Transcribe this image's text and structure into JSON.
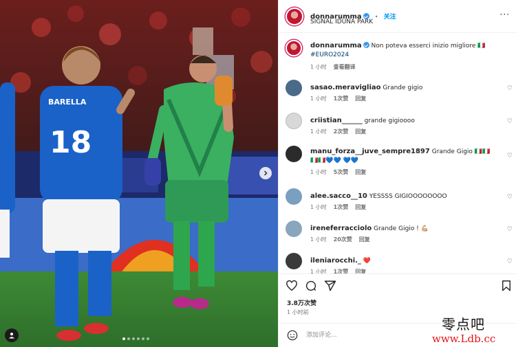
{
  "post": {
    "username": "donnarumma",
    "location": "SIGNAL IDUNA PARK",
    "follow_label": "关注",
    "more_label": "···",
    "caption_text": "Non poteva esserci inizio migliore 🇮🇹",
    "caption_hashtag": "#EURO2024",
    "caption_time": "1 小时",
    "caption_translate": "查看翻译",
    "likes": "3.8万次赞",
    "time_ago": "1 小时前",
    "add_comment_placeholder": "添加评论..."
  },
  "photo": {
    "player_number": "18",
    "player_name": "BARELLA",
    "slide_count": 6,
    "active_slide": 0
  },
  "comments": [
    {
      "username": "sasao.meravigliao",
      "text": "Grande gigio",
      "time": "1 小时",
      "likes": "1次赞",
      "reply": "回复",
      "avatar_color": "#4a6a8a"
    },
    {
      "username": "criistian______",
      "text": "grande gigioooo",
      "time": "1 小时",
      "likes": "2次赞",
      "reply": "回复",
      "avatar_color": "#d8d8d8"
    },
    {
      "username": "manu_forza__juve_sempre1897",
      "text": "Grande Gigio 🇮🇹🇮🇹🇮🇹🇮🇹💙💙 💙💙",
      "time": "1 小时",
      "likes": "5次赞",
      "reply": "回复",
      "avatar_color": "#2b2b2b"
    },
    {
      "username": "alee.sacco__10",
      "text": "YESSSS GIGIOOOOOOOO",
      "time": "1 小时",
      "likes": "1次赞",
      "reply": "回复",
      "avatar_color": "#7aa0c0"
    },
    {
      "username": "ireneferracciolo",
      "text": "Grande Gigio ! 💪🏼",
      "time": "1 小时",
      "likes": "20次赞",
      "reply": "回复",
      "avatar_color": "#8aa6bd"
    },
    {
      "username": "ileniarocchi._",
      "text": "❤️",
      "time": "1 小时",
      "likes": "1次赞",
      "reply": "回复",
      "avatar_color": "#3a3a3a"
    }
  ],
  "watermark": {
    "line1": "零点吧",
    "line2": "www.Ldb.cc"
  },
  "colors": {
    "accent": "#0095f6",
    "verified": "#3897f0",
    "link": "#00376b",
    "muted": "#737373",
    "watermark_red": "#e0161b"
  }
}
